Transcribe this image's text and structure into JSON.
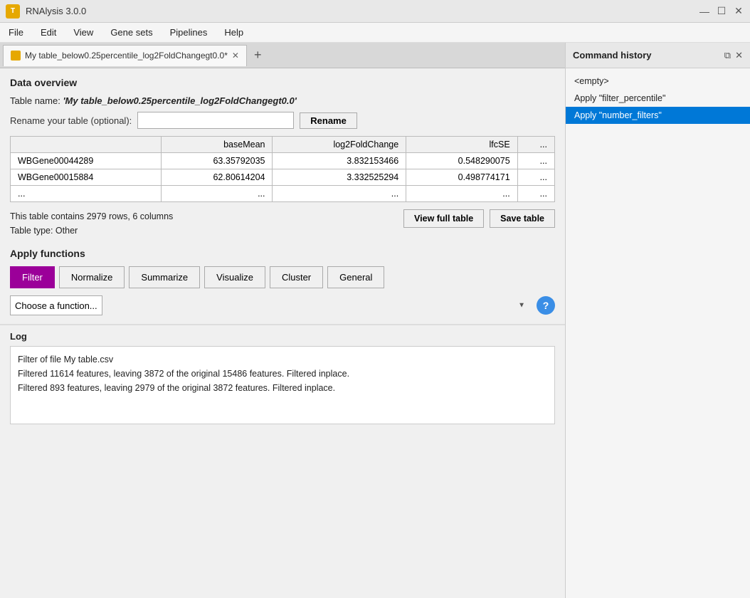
{
  "app": {
    "icon_label": "T",
    "title": "RNAlysis 3.0.0",
    "controls": {
      "minimize": "—",
      "maximize": "☐",
      "close": "✕"
    }
  },
  "menu": {
    "items": [
      "File",
      "Edit",
      "View",
      "Gene sets",
      "Pipelines",
      "Help"
    ]
  },
  "tab": {
    "label": "My table_below0.25percentile_log2FoldChangegt0.0*",
    "close_icon": "✕",
    "add_icon": "+"
  },
  "data_overview": {
    "section_title": "Data overview",
    "table_name_label": "Table name: ",
    "table_name_value": "'My table_below0.25percentile_log2FoldChangegt0.0'",
    "rename_label": "Rename your table (optional):",
    "rename_placeholder": "",
    "rename_btn": "Rename",
    "table_headers": [
      "",
      "baseMean",
      "log2FoldChange",
      "lfcSE",
      "..."
    ],
    "table_rows": [
      [
        "WBGene00044289",
        "63.35792035",
        "3.832153466",
        "0.548290075",
        "..."
      ],
      [
        "WBGene00015884",
        "62.80614204",
        "3.332525294",
        "0.498774171",
        "..."
      ],
      [
        "...",
        "...",
        "...",
        "...",
        "..."
      ]
    ],
    "info_rows": "2979",
    "info_cols": "6",
    "info_rows_label": "This table contains 2979 rows, 6 columns",
    "info_type": "Table type: Other",
    "view_full_table_btn": "View full table",
    "save_table_btn": "Save table"
  },
  "apply_functions": {
    "section_title": "Apply functions",
    "buttons": [
      "Filter",
      "Normalize",
      "Summarize",
      "Visualize",
      "Cluster",
      "General"
    ],
    "active_button": "Filter",
    "dropdown_placeholder": "Choose a function...",
    "help_icon": "?"
  },
  "log": {
    "section_title": "Log",
    "lines": [
      "Filter of file My table.csv",
      "Filtered 11614 features, leaving 3872 of the original 15486 features. Filtered inplace.",
      "Filtered 893 features, leaving 2979 of the original 3872 features. Filtered inplace."
    ]
  },
  "command_history": {
    "title": "Command history",
    "restore_icon": "⧉",
    "close_icon": "✕",
    "items": [
      {
        "label": "<empty>",
        "selected": false
      },
      {
        "label": "Apply \"filter_percentile\"",
        "selected": false
      },
      {
        "label": "Apply \"number_filters\"",
        "selected": true
      }
    ]
  }
}
